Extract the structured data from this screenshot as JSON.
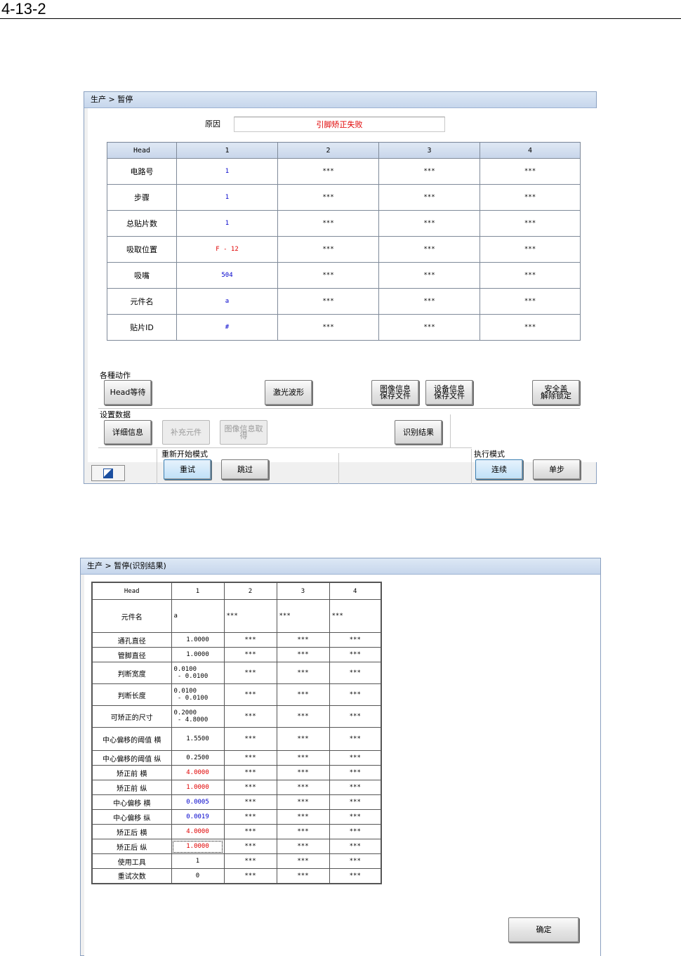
{
  "page_number": "4-13-2",
  "window1": {
    "title": "生产 > 暂停",
    "reason_label": "原因",
    "reason_value": "引脚矫正失败",
    "table": {
      "headers": [
        "Head",
        "1",
        "2",
        "3",
        "4"
      ],
      "rows": [
        {
          "label": "电路号",
          "values": [
            "1",
            "***",
            "***",
            "***"
          ],
          "color": "blue"
        },
        {
          "label": "步骤",
          "values": [
            "1",
            "***",
            "***",
            "***"
          ],
          "color": "blue"
        },
        {
          "label": "总贴片数",
          "values": [
            "1",
            "***",
            "***",
            "***"
          ],
          "color": "blue"
        },
        {
          "label": "吸取位置",
          "values": [
            "F - 12",
            "***",
            "***",
            "***"
          ],
          "color": "red"
        },
        {
          "label": "吸嘴",
          "values": [
            "504",
            "***",
            "***",
            "***"
          ],
          "color": "blue"
        },
        {
          "label": "元件名",
          "values": [
            "a",
            "***",
            "***",
            "***"
          ],
          "color": "blue"
        },
        {
          "label": "贴片ID",
          "values": [
            "#",
            "***",
            "***",
            "***"
          ],
          "color": "blue"
        }
      ]
    },
    "actions_label": "各種动作",
    "btn_head_wait": "Head等待",
    "btn_laser": "激光波形",
    "btn_image_save": "图像信息\n保存文件",
    "btn_device_save": "设备信息\n保存文件",
    "btn_safety": "安全盖\n解除锁定",
    "settings_label": "设置数据",
    "btn_detail": "详细信息",
    "btn_supplement": "补充元件",
    "btn_image_get": "图像信息取得",
    "btn_recog": "识别结果",
    "restart_label": "重新开始模式",
    "btn_retry": "重试",
    "btn_skip": "跳过",
    "exec_label": "执行模式",
    "btn_continuous": "连续",
    "btn_step": "单步"
  },
  "window2": {
    "title": "生产 > 暂停(识别结果)",
    "table": {
      "headers": [
        "Head",
        "1",
        "2",
        "3",
        "4"
      ],
      "rows": [
        {
          "label": "元件名",
          "v1": "a",
          "rest": "***",
          "style": "tall"
        },
        {
          "label": "通孔直径",
          "v1": "1.0000",
          "rest": "***",
          "style": "normal"
        },
        {
          "label": "管脚直径",
          "v1": "1.0000",
          "rest": "***",
          "style": "normal"
        },
        {
          "label": "判断宽度",
          "v1": "0.0100\n - 0.0100",
          "rest": "***",
          "style": "double"
        },
        {
          "label": "判断长度",
          "v1": "0.0100\n - 0.0100",
          "rest": "***",
          "style": "double"
        },
        {
          "label": "可矫正的尺寸",
          "v1": "0.2000\n - 4.8000",
          "rest": "***",
          "style": "double"
        },
        {
          "label": "中心偏移的阈值 横",
          "v1": "1.5500",
          "rest": "***",
          "style": "double1"
        },
        {
          "label": "中心偏移的阈值 纵",
          "v1": "0.2500",
          "rest": "***",
          "style": "normal"
        },
        {
          "label": "矫正前 横",
          "v1": "4.0000",
          "rest": "***",
          "style": "normal",
          "color": "red"
        },
        {
          "label": "矫正前 纵",
          "v1": "1.0000",
          "rest": "***",
          "style": "normal",
          "color": "red"
        },
        {
          "label": "中心偏移 横",
          "v1": "0.0005",
          "rest": "***",
          "style": "normal",
          "color": "blue"
        },
        {
          "label": "中心偏移 纵",
          "v1": "0.0019",
          "rest": "***",
          "style": "normal",
          "color": "blue"
        },
        {
          "label": "矫正后 横",
          "v1": "4.0000",
          "rest": "***",
          "style": "normal",
          "color": "red"
        },
        {
          "label": "矫正后 纵",
          "v1": "1.0000",
          "rest": "***",
          "style": "normal",
          "color": "red",
          "selected": true
        },
        {
          "label": "使用工具",
          "v1": "1",
          "rest": "***",
          "style": "normal"
        },
        {
          "label": "重试次数",
          "v1": "0",
          "rest": "***",
          "style": "normal"
        }
      ]
    },
    "btn_ok": "确定"
  },
  "colors": {
    "title_bar": "#c6d6ec",
    "reason_text": "#e00000",
    "value_blue": "#0000cc",
    "value_red": "#e00000"
  }
}
